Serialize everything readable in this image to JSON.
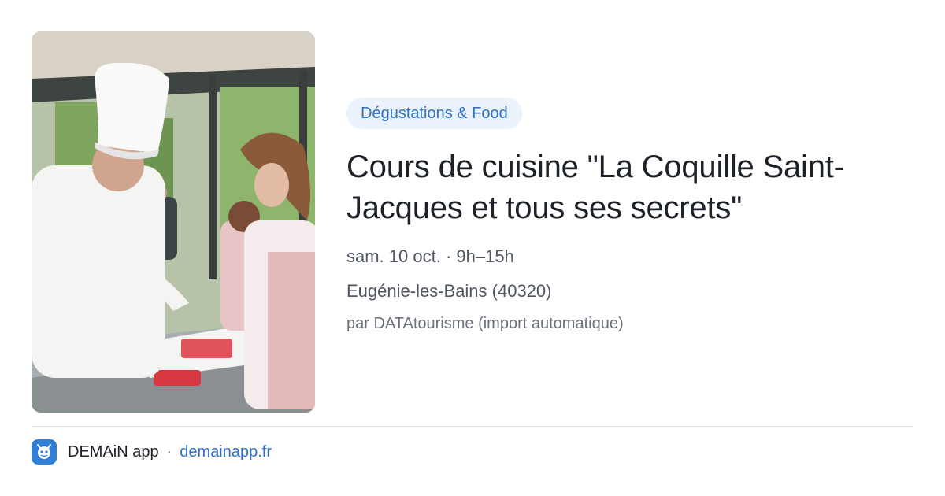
{
  "event": {
    "category": "Dégustations & Food",
    "title": "Cours de cuisine \"La Coquille Saint-Jacques et tous ses secrets\"",
    "datetime": "sam. 10 oct. · 9h–15h",
    "location": "Eugénie-les-Bains (40320)",
    "source": "par DATAtourisme (import automatique)"
  },
  "footer": {
    "app_name": "DEMAiN app",
    "separator": "·",
    "domain": "demainapp.fr"
  },
  "colors": {
    "accent": "#2f6fc6",
    "tag_background": "#eaf2fc",
    "logo": "#2f80d6"
  },
  "icons": {
    "logo": "demain-app-logo-icon"
  }
}
